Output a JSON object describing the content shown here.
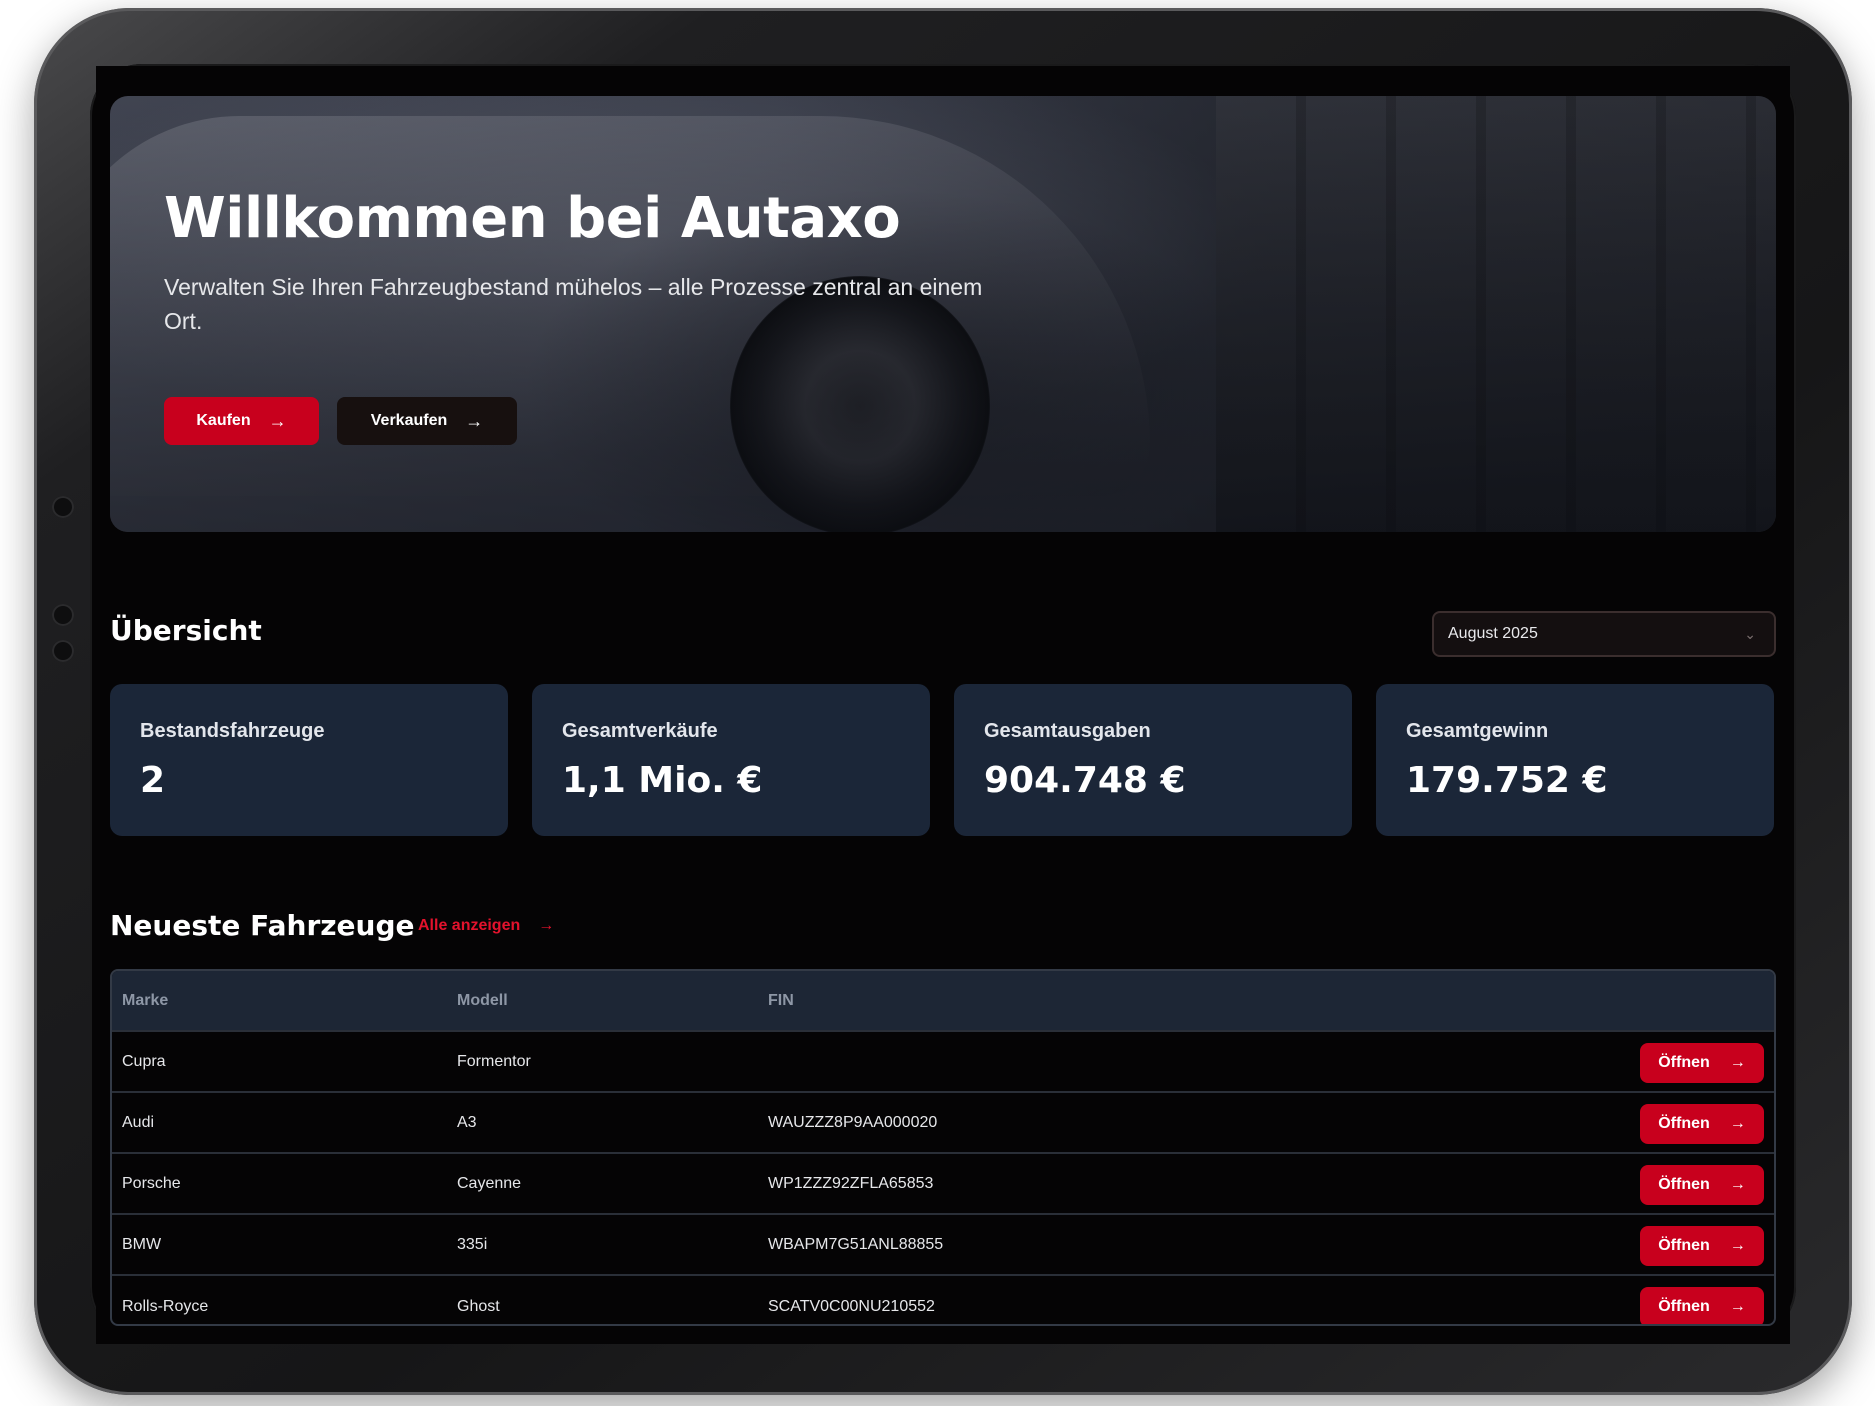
{
  "hero": {
    "title": "Willkommen bei Autaxo",
    "subtitle": "Verwalten Sie Ihren Fahrzeugbestand mühelos – alle Prozesse zentral an einem Ort.",
    "buy_label": "Kaufen",
    "sell_label": "Verkaufen",
    "arrow": "→"
  },
  "overview": {
    "title": "Übersicht",
    "month": "August 2025",
    "month_chevron": "⌄",
    "cards": [
      {
        "label": "Bestandsfahrzeuge",
        "value": "2"
      },
      {
        "label": "Gesamtverkäufe",
        "value": "1,1 Mio. €"
      },
      {
        "label": "Gesamtausgaben",
        "value": "904.748 €"
      },
      {
        "label": "Gesamtgewinn",
        "value": "179.752 €"
      }
    ]
  },
  "latest": {
    "title": "Neueste Fahrzeuge",
    "show_all": "Alle anzeigen",
    "arrow": "→",
    "columns": {
      "marke": "Marke",
      "modell": "Modell",
      "fin": "FIN"
    },
    "open_label": "Öffnen",
    "rows": [
      {
        "marke": "Cupra",
        "modell": "Formentor",
        "fin": ""
      },
      {
        "marke": "Audi",
        "modell": "A3",
        "fin": "WAUZZZ8P9AA000020"
      },
      {
        "marke": "Porsche",
        "modell": "Cayenne",
        "fin": "WP1ZZZ92ZFLA65853"
      },
      {
        "marke": "BMW",
        "modell": "335i",
        "fin": "WBAPM7G51ANL88855"
      },
      {
        "marke": "Rolls-Royce",
        "modell": "Ghost",
        "fin": "SCATV0C00NU210552"
      }
    ]
  },
  "colors": {
    "accent": "#c8001d",
    "card_bg": "#1b2638",
    "background": "#050405"
  }
}
